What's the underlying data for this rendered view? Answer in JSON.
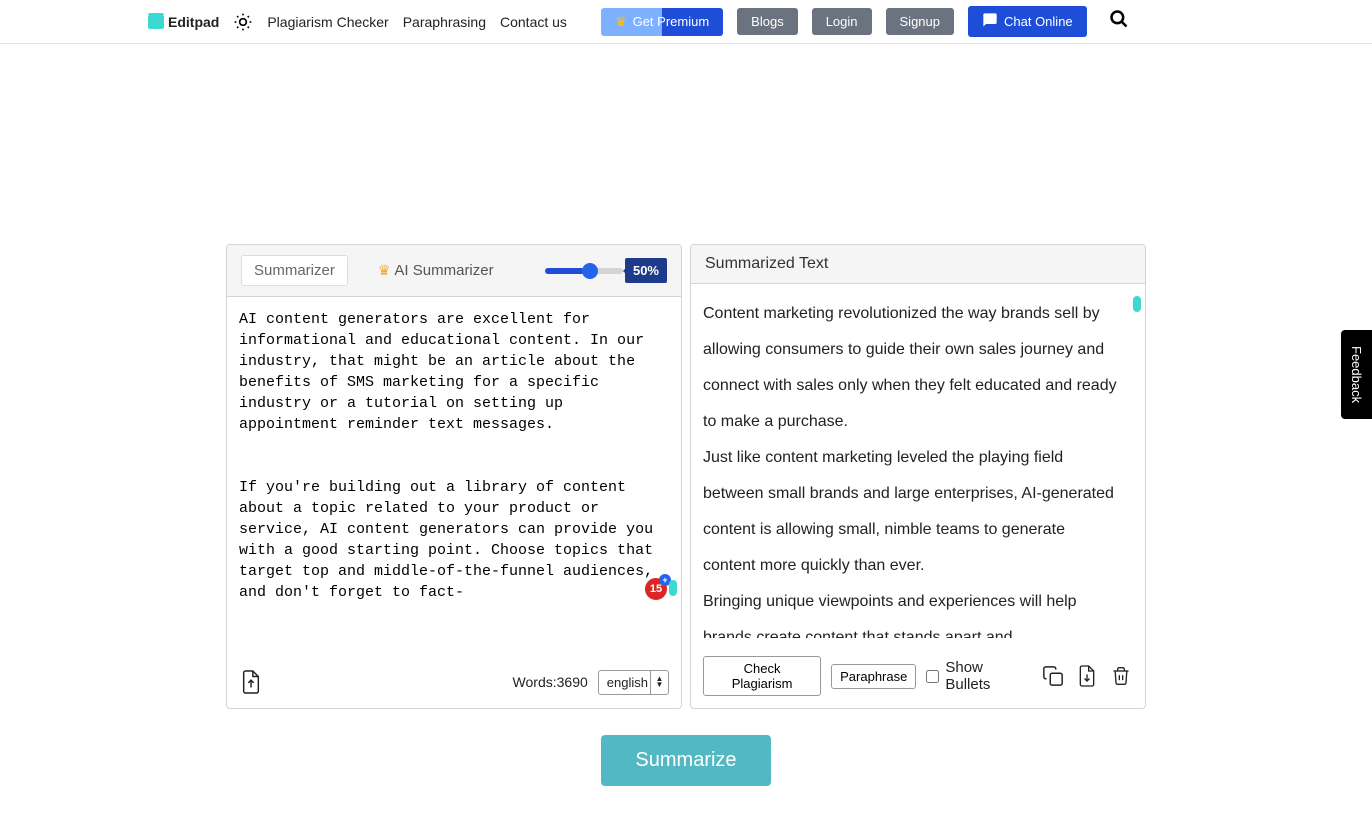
{
  "header": {
    "logo_text": "Editpad",
    "nav": {
      "plagiarism": "Plagiarism Checker",
      "paraphrasing": "Paraphrasing",
      "contact": "Contact us"
    },
    "buttons": {
      "premium": "Get Premium",
      "blogs": "Blogs",
      "login": "Login",
      "signup": "Signup",
      "chat": "Chat Online"
    }
  },
  "tool": {
    "tabs": {
      "summarizer": "Summarizer",
      "ai_summarizer": "AI Summarizer"
    },
    "slider_value": "50%",
    "input_text": "AI content generators are excellent for informational and educational content. In our industry, that might be an article about the benefits of SMS marketing for a specific industry or a tutorial on setting up appointment reminder text messages.\n\n\nIf you're building out a library of content about a topic related to your product or service, AI content generators can provide you with a good starting point. Choose topics that target top and middle-of-the-funnel audiences, and don't forget to fact-",
    "words_label": "Words:",
    "words_count": "3690",
    "language": "english",
    "badge_count": "15"
  },
  "output": {
    "title": "Summarized Text",
    "p1": "Content marketing revolutionized the way brands sell by allowing consumers to guide their own sales journey and connect with sales only when they felt educated and ready to make a purchase.",
    "p2": "Just like content marketing leveled the playing field between small brands and large enterprises, AI-generated content is allowing small, nimble teams to generate content more quickly than ever.",
    "p3": "Bringing unique viewpoints and experiences will help brands create content that stands apart and",
    "check_plag": "Check Plagiarism",
    "paraphrase": "Paraphrase",
    "show_bullets": "Show Bullets"
  },
  "cta": {
    "summarize": "Summarize"
  },
  "feedback": "Feedback"
}
